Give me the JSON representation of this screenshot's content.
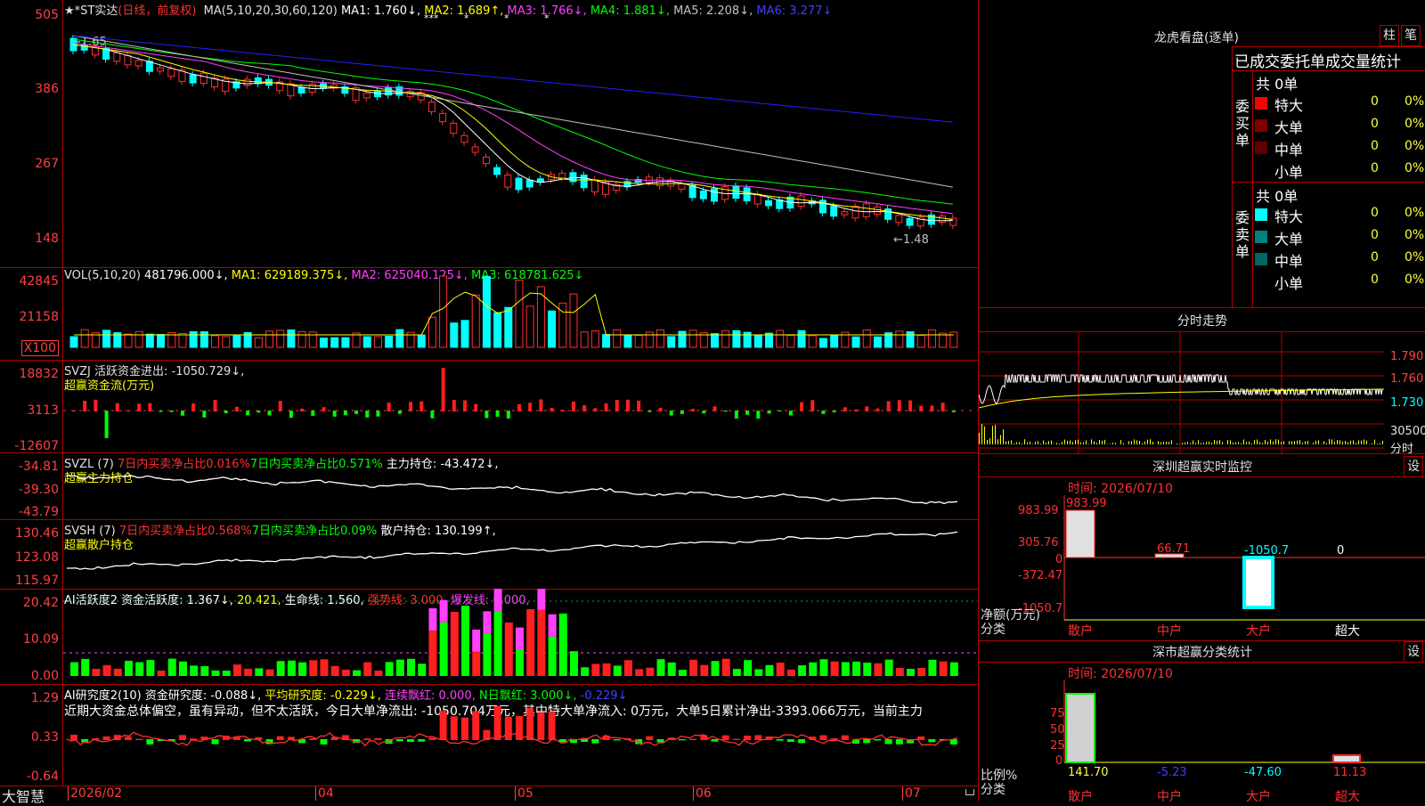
{
  "title": {
    "stock": "★*ST实达",
    "period": "(日线，前复权)",
    "ma_label": "MA(5,10,20,30,60,120)",
    "ma1": "MA1: 1.760↓,",
    "ma2": "MA2: 1.689↑,",
    "ma3": "MA3: 1.766↓,",
    "ma4": "MA4: 1.881↓,",
    "ma5": "MA5: 2.208↓,",
    "ma6": "MA6: 3.277↓"
  },
  "price_axis": [
    "505",
    "386",
    "267",
    "148"
  ],
  "price_marks": {
    "high": "1.65",
    "low": "1.48"
  },
  "vol": {
    "label": "VOL(5,10,20)",
    "value": "481796.000↓,",
    "ma1": "MA1: 629189.375↓,",
    "ma2": "MA2: 625040.125↓,",
    "ma3": "MA3: 618781.625↓",
    "axis": [
      "42845",
      "21158"
    ],
    "unit": "X100"
  },
  "svzj": {
    "label": "SVZJ  活跃资金进出: -1050.729↓,",
    "sub": "超赢资金流(万元)",
    "axis": [
      "18832",
      "3113",
      "-12607"
    ]
  },
  "svzl": {
    "label": "SVZL (7)",
    "a": "7日内买卖净占比0.016%",
    "b": "7日内买卖净占比0.571%",
    "c": "主力持仓: -43.472↓,",
    "sub": "超赢主力持仓",
    "axis": [
      "-34.81",
      "-39.30",
      "-43.79"
    ]
  },
  "svsh": {
    "label": "SVSH (7)",
    "a": "7日内买卖净占比0.568%",
    "b": "7日内买卖净占比0.09%",
    "c": "散户持仓: 130.199↑,",
    "sub": "超赢散户持仓",
    "axis": [
      "130.46",
      "123.08",
      "115.97"
    ]
  },
  "ai1": {
    "label": "AI活跃度2 资金活跃度: 1.367↓,",
    "v2": "20.421,",
    "v3": "生命线: 1.560,",
    "v4": "强势线: 3.000,",
    "v5": "爆发线: 6.000,",
    "axis": [
      "20.42",
      "10.09",
      "0.00"
    ]
  },
  "ai2": {
    "label": "AI研究度2(10) 资金研究度: -0.088↓,",
    "v2": "平均研究度: -0.229↓,",
    "v3": "连续飘红: 0.000,",
    "v4": "N日飘红: 3.000↓,",
    "v5": "-0.229↓",
    "text": "近期大资金总体偏空，虽有异动，但不太活跃，今日大单净流出: -1050.704万元，其中特大单净流入: 0万元，大单5日累计净出-3393.066万元，当前主力",
    "axis": [
      "1.29",
      "0.33",
      "-0.64"
    ]
  },
  "xaxis": {
    "brand": "大智慧",
    "labels": [
      "2026/02",
      "04",
      "05",
      "06",
      "07"
    ]
  },
  "right": {
    "dragon_title": "龙虎看盘(逐单)",
    "btn1": "柱",
    "btn2": "笔",
    "table_title": "已成交委托单成交量统计",
    "buy_side": "委买单",
    "sell_side": "委卖单",
    "buy_total": "共 0单",
    "sell_total": "共 0单",
    "buy_rows": [
      {
        "name": "特大",
        "count": "0",
        "pct": "0%",
        "color": "#ff0000"
      },
      {
        "name": "大单",
        "count": "0",
        "pct": "0%",
        "color": "#800000"
      },
      {
        "name": "中单",
        "count": "0",
        "pct": "0%",
        "color": "#600000"
      },
      {
        "name": "小单",
        "count": "0",
        "pct": "0%",
        "color": "#000000"
      }
    ],
    "sell_rows": [
      {
        "name": "特大",
        "count": "0",
        "pct": "0%",
        "color": "#00ffff"
      },
      {
        "name": "大单",
        "count": "0",
        "pct": "0%",
        "color": "#008080"
      },
      {
        "name": "中单",
        "count": "0",
        "pct": "0%",
        "color": "#006666"
      },
      {
        "name": "小单",
        "count": "0",
        "pct": "0%",
        "color": "#000000"
      }
    ],
    "intraday_title": "分时走势",
    "intraday_axis": [
      "1.790",
      "1.760",
      "1.730",
      "30500",
      "分时"
    ],
    "monitor_title": "深圳超赢实时监控",
    "monitor_btn": "设",
    "monitor_time": "时间: 2026/07/10",
    "monitor_axis": [
      "983.99",
      "305.76",
      "0",
      "-372.47",
      "-1050.7"
    ],
    "monitor_values": [
      "983.99",
      "66.71",
      "-1050.7",
      "0"
    ],
    "monitor_unit": "净额(万元)",
    "monitor_cat": "分类",
    "categories": [
      "散户",
      "中户",
      "大户",
      "超大"
    ],
    "stats_title": "深市超赢分类统计",
    "stats_btn": "设",
    "stats_time": "时间: 2026/07/10",
    "stats_axis": [
      "75",
      "50",
      "25",
      "0"
    ],
    "stats_values": [
      "141.70",
      "-5.23",
      "-47.60",
      "11.13"
    ],
    "stats_unit": "比例%",
    "stats_cat": "分类"
  }
}
